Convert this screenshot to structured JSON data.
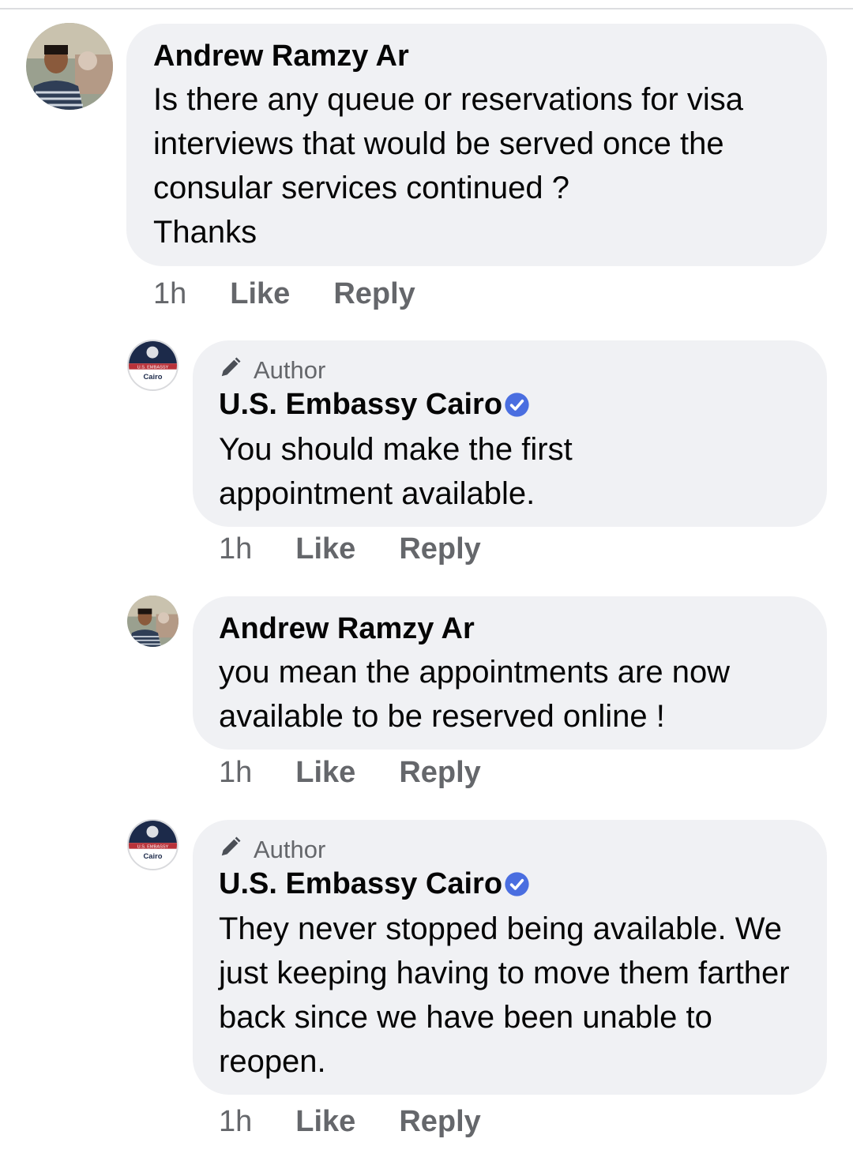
{
  "comments": [
    {
      "author": "Andrew Ramzy Ar",
      "text": "Is there any queue or reservations for visa interviews that would be served once the consular services continued ?\nThanks",
      "time": "1h",
      "like": "Like",
      "reply": "Reply"
    },
    {
      "badge": "Author",
      "author": "U.S. Embassy Cairo",
      "avatar_text_top": "U.S. EMBASSY",
      "avatar_text_bottom": "Cairo",
      "text": "You should make the first\nappointment available.",
      "time": "1h",
      "like": "Like",
      "reply": "Reply"
    },
    {
      "author": "Andrew Ramzy Ar",
      "text": "you mean the appointments are now available to be reserved online !",
      "time": "1h",
      "like": "Like",
      "reply": "Reply"
    },
    {
      "badge": "Author",
      "author": "U.S. Embassy Cairo",
      "avatar_text_top": "U.S. EMBASSY",
      "avatar_text_bottom": "Cairo",
      "text": "They never stopped being available. We just keeping having to move them farther back since we have been unable to reopen.",
      "time": "1h",
      "like": "Like",
      "reply": "Reply"
    }
  ],
  "icons": {
    "badge": "pencil-icon",
    "verified": "verified-badge-icon"
  },
  "colors": {
    "bubble": "#f0f1f4",
    "meta": "#65676b",
    "verified": "#4a6ee0",
    "embassy_navy": "#1c2a4a",
    "embassy_red": "#b8323a"
  }
}
